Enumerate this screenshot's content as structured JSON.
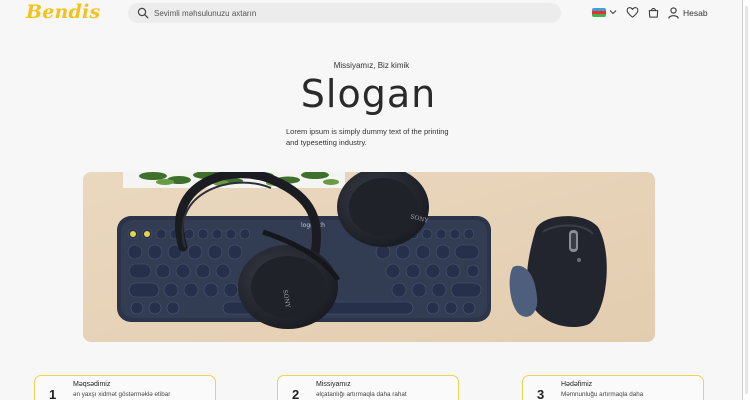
{
  "header": {
    "logo": "Bendis",
    "search_placeholder": "Sevimli məhsulunuzu axtarın",
    "account_label": "Hesab"
  },
  "icons": {
    "search": "search-icon",
    "flag": "azerbaijan-flag-icon",
    "language_dropdown": "chevron-down-icon",
    "wishlist": "heart-icon",
    "cart": "shopping-bag-icon",
    "account": "user-icon"
  },
  "hero": {
    "eyebrow": "Missiyamız, Biz kimik",
    "title": "Slogan",
    "description": "Lorem ipsum is simply dummy text of the printing and typesetting industry."
  },
  "image_text": {
    "keyboard_brand": "logitech",
    "headphone_brand": "SONY"
  },
  "cards": [
    {
      "number": "1",
      "title": "Məqsədimiz",
      "text": "ən yaxşı xidmət göstərməklə etibar"
    },
    {
      "number": "2",
      "title": "Missiyamız",
      "text": "əlçatanlığı artırmaqla daha rahat"
    },
    {
      "number": "3",
      "title": "Hədəfimiz",
      "text": "Məmnunluğu artırmaqla daha"
    }
  ],
  "colors": {
    "brand": "#f4c21a",
    "card_border": "#f2cf55",
    "page_background": "#f7f7f7",
    "search_background": "#ececec"
  }
}
